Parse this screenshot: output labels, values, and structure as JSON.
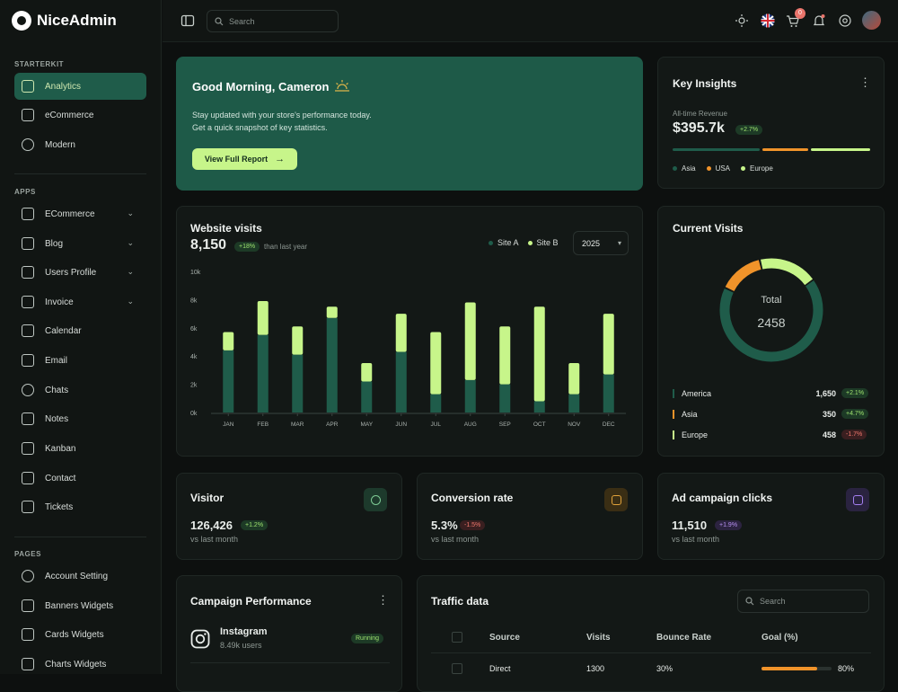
{
  "app": {
    "name": "NiceAdmin"
  },
  "sidebar": {
    "sections": [
      {
        "title": "STARTERKIT",
        "items": [
          {
            "label": "Analytics",
            "active": true
          },
          {
            "label": "eCommerce"
          },
          {
            "label": "Modern"
          }
        ]
      },
      {
        "title": "APPS",
        "items": [
          {
            "label": "ECommerce",
            "chevron": true
          },
          {
            "label": "Blog",
            "chevron": true
          },
          {
            "label": "Users Profile",
            "chevron": true
          },
          {
            "label": "Invoice",
            "chevron": true
          },
          {
            "label": "Calendar"
          },
          {
            "label": "Email"
          },
          {
            "label": "Chats"
          },
          {
            "label": "Notes"
          },
          {
            "label": "Kanban"
          },
          {
            "label": "Contact"
          },
          {
            "label": "Tickets"
          }
        ]
      },
      {
        "title": "PAGES",
        "items": [
          {
            "label": "Account Setting"
          },
          {
            "label": "Banners Widgets"
          },
          {
            "label": "Cards Widgets"
          },
          {
            "label": "Charts Widgets"
          }
        ]
      }
    ]
  },
  "topbar": {
    "search_placeholder": "Search",
    "cart_count": "0"
  },
  "hero": {
    "title": "Good Morning, Cameron",
    "line1": "Stay updated with your store's performance today.",
    "line2": "Get a quick snapshot of key statistics.",
    "button": "View Full Report"
  },
  "insights": {
    "title": "Key Insights",
    "label": "All-time Revenue",
    "value": "$395.7k",
    "change": "+2.7%",
    "legend": [
      "Asia",
      "USA",
      "Europe"
    ],
    "colors": [
      "#1f5c4a",
      "#f0932a",
      "#c7f58a"
    ]
  },
  "visits": {
    "title": "Website visits",
    "value": "8,150",
    "change": "+18%",
    "caption": "than last year",
    "legend_a": "Site A",
    "legend_b": "Site B",
    "year": "2025"
  },
  "chart_data": {
    "type": "bar",
    "stacked": true,
    "categories": [
      "JAN",
      "FEB",
      "MAR",
      "APR",
      "MAY",
      "JUN",
      "JUL",
      "AUG",
      "SEP",
      "OCT",
      "NOV",
      "DEC"
    ],
    "series": [
      {
        "name": "Site A",
        "values": [
          4.4,
          5.5,
          4.1,
          6.7,
          2.2,
          4.3,
          1.3,
          2.3,
          2.0,
          0.8,
          1.3,
          2.7
        ],
        "color": "#1f5c4a"
      },
      {
        "name": "Site B",
        "values": [
          1.3,
          2.4,
          2.0,
          0.8,
          1.3,
          2.7,
          4.4,
          5.5,
          4.1,
          6.7,
          2.2,
          4.3
        ],
        "color": "#c7f58a"
      }
    ],
    "yticks": [
      "0k",
      "2k",
      "4k",
      "6k",
      "8k",
      "10k"
    ],
    "ylim": [
      0,
      10
    ]
  },
  "current_visits": {
    "title": "Current Visits",
    "total_label": "Total",
    "total": "2458",
    "rows": [
      {
        "name": "America",
        "value": "1,650",
        "change": "+2.1%",
        "color": "#1f5c4a",
        "tone": "g",
        "share": 67.1
      },
      {
        "name": "Asia",
        "value": "350",
        "change": "+4.7%",
        "color": "#f0932a",
        "tone": "g",
        "share": 14.2
      },
      {
        "name": "Europe",
        "value": "458",
        "change": "-1.7%",
        "color": "#c7f58a",
        "tone": "r",
        "share": 18.7
      }
    ]
  },
  "stats": [
    {
      "title": "Visitor",
      "value": "126,426",
      "change": "+1.2%",
      "tone": "g",
      "caption": "vs last month",
      "icon": "user-icon"
    },
    {
      "title": "Conversion rate",
      "value": "5.3%",
      "change": "-1.5%",
      "tone": "r",
      "caption": "vs last month",
      "icon": "bag-icon"
    },
    {
      "title": "Ad campaign clicks",
      "value": "11,510",
      "change": "+1.9%",
      "tone": "p",
      "caption": "vs last month",
      "icon": "box-icon"
    }
  ],
  "campaign": {
    "title": "Campaign Performance",
    "name": "Instagram",
    "users": "8.49k users",
    "status": "Running"
  },
  "traffic": {
    "title": "Traffic data",
    "search_placeholder": "Search",
    "columns": [
      "Source",
      "Visits",
      "Bounce Rate",
      "Goal (%)"
    ],
    "rows": [
      {
        "source": "Direct",
        "visits": "1300",
        "bounce": "30%",
        "goal": "80%",
        "goal_value": 80
      }
    ]
  }
}
